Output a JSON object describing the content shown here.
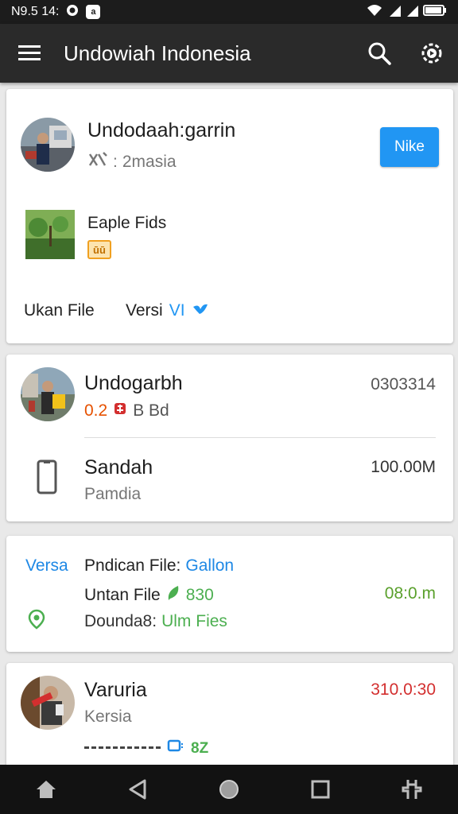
{
  "status_bar": {
    "time": "N9.5 14:",
    "left_badge": "a"
  },
  "app_bar": {
    "title": "Undowiah Indonesia"
  },
  "card1": {
    "title": "Undodaah:garrin",
    "subtitle": "2masia",
    "button_label": "Nike",
    "file_label": "Eaple Fids",
    "file_badge": "ūū",
    "footer_left": "Ukan File",
    "footer_right_label": "Versi",
    "footer_right_value": "VI"
  },
  "card2": {
    "row1_title": "Undogarbh",
    "row1_sub_value": "0.2",
    "row1_sub_tail": "B Bd",
    "row1_right": "0303314",
    "row2_title": "Sandah",
    "row2_sub": "Pamdia",
    "row2_right": "100.00M"
  },
  "card3": {
    "left_label": "Versa",
    "line1_prefix": "Pndican File:",
    "line1_value": "Gallon",
    "line2_prefix": "Untan File",
    "line2_value": "830",
    "line2_right": "08:0.m",
    "line3_prefix": "Dounda8:",
    "line3_value": "Ulm Fies"
  },
  "card4": {
    "title": "Varuria",
    "sub": "Kersia",
    "right": "310.0:30",
    "partial_value": "8Z"
  },
  "colors": {
    "accent_blue": "#2196f3",
    "green": "#4caf50",
    "red": "#d32f2f",
    "orange": "#e65100"
  }
}
